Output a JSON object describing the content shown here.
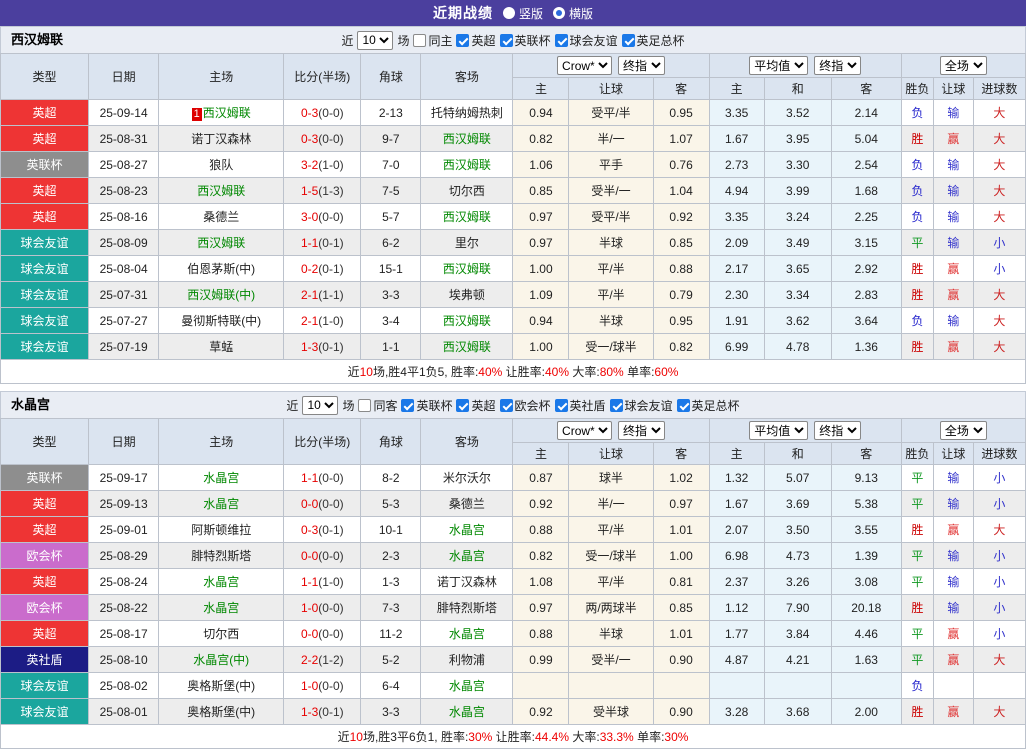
{
  "titlebar": {
    "title": "近期战绩",
    "vertical_label": "竖版",
    "horizontal_label": "横版",
    "vertical_checked": false,
    "horizontal_checked": true
  },
  "filter_labels": {
    "near": "近",
    "count": "10",
    "games": "场"
  },
  "header": {
    "cols": {
      "type": "类型",
      "date": "日期",
      "home": "主场",
      "score": "比分(半场)",
      "corner": "角球",
      "away": "客场"
    },
    "dropdowns": {
      "odds_source": "Crow*",
      "odds_stage": "终指",
      "avg": "平均值",
      "avg_stage": "终指",
      "scope": "全场"
    },
    "sub_cols": [
      "主",
      "让球",
      "客",
      "主",
      "和",
      "客",
      "胜负",
      "让球",
      "进球数"
    ]
  },
  "league_colors": {
    "英超": "#ee3434",
    "英联杯": "#8e8e8e",
    "球会友谊": "#1ba69e",
    "欧会杯": "#ca6ccc",
    "英社盾": "#1c1c85"
  },
  "result_colors": {
    "胜": "#cc0000",
    "赢": "#e03333",
    "平": "#119922",
    "负": "#2222cc",
    "输": "#3333cc",
    "大": "#cc2222",
    "小": "#3333cc"
  },
  "sections": [
    {
      "team": "西汉姆联",
      "same_label": "同主",
      "leagues": [
        "英超",
        "英联杯",
        "球会友谊",
        "英足总杯"
      ],
      "rows": [
        {
          "league": "英超",
          "date": "25-09-14",
          "badge": "1",
          "home": "西汉姆联",
          "homeGreen": true,
          "score": "0-3",
          "half": "(0-0)",
          "corner": "2-13",
          "away": "托特纳姆热刺",
          "awayGreen": false,
          "o1": "0.94",
          "hc": "受平/半",
          "o2": "0.95",
          "a1": "3.35",
          "a2": "3.52",
          "a3": "2.14",
          "r1": "负",
          "r2": "输",
          "r3": "大"
        },
        {
          "league": "英超",
          "date": "25-08-31",
          "home": "诺丁汉森林",
          "homeGreen": false,
          "score": "0-3",
          "half": "(0-0)",
          "corner": "9-7",
          "away": "西汉姆联",
          "awayGreen": true,
          "o1": "0.82",
          "hc": "半/一",
          "o2": "1.07",
          "a1": "1.67",
          "a2": "3.95",
          "a3": "5.04",
          "r1": "胜",
          "r2": "赢",
          "r3": "大"
        },
        {
          "league": "英联杯",
          "date": "25-08-27",
          "home": "狼队",
          "homeGreen": false,
          "score": "3-2",
          "half": "(1-0)",
          "corner": "7-0",
          "away": "西汉姆联",
          "awayGreen": true,
          "o1": "1.06",
          "hc": "平手",
          "o2": "0.76",
          "a1": "2.73",
          "a2": "3.30",
          "a3": "2.54",
          "r1": "负",
          "r2": "输",
          "r3": "大"
        },
        {
          "league": "英超",
          "date": "25-08-23",
          "home": "西汉姆联",
          "homeGreen": true,
          "score": "1-5",
          "half": "(1-3)",
          "corner": "7-5",
          "away": "切尔西",
          "awayGreen": false,
          "o1": "0.85",
          "hc": "受半/一",
          "o2": "1.04",
          "a1": "4.94",
          "a2": "3.99",
          "a3": "1.68",
          "r1": "负",
          "r2": "输",
          "r3": "大"
        },
        {
          "league": "英超",
          "date": "25-08-16",
          "home": "桑德兰",
          "homeGreen": false,
          "score": "3-0",
          "half": "(0-0)",
          "corner": "5-7",
          "away": "西汉姆联",
          "awayGreen": true,
          "o1": "0.97",
          "hc": "受平/半",
          "o2": "0.92",
          "a1": "3.35",
          "a2": "3.24",
          "a3": "2.25",
          "r1": "负",
          "r2": "输",
          "r3": "大"
        },
        {
          "league": "球会友谊",
          "date": "25-08-09",
          "home": "西汉姆联",
          "homeGreen": true,
          "score": "1-1",
          "half": "(0-1)",
          "corner": "6-2",
          "away": "里尔",
          "awayGreen": false,
          "o1": "0.97",
          "hc": "半球",
          "o2": "0.85",
          "a1": "2.09",
          "a2": "3.49",
          "a3": "3.15",
          "r1": "平",
          "r2": "输",
          "r3": "小"
        },
        {
          "league": "球会友谊",
          "date": "25-08-04",
          "home": "伯恩茅斯(中)",
          "homeGreen": false,
          "score": "0-2",
          "half": "(0-1)",
          "corner": "15-1",
          "away": "西汉姆联",
          "awayGreen": true,
          "o1": "1.00",
          "hc": "平/半",
          "o2": "0.88",
          "a1": "2.17",
          "a2": "3.65",
          "a3": "2.92",
          "r1": "胜",
          "r2": "赢",
          "r3": "小"
        },
        {
          "league": "球会友谊",
          "date": "25-07-31",
          "home": "西汉姆联(中)",
          "homeGreen": true,
          "score": "2-1",
          "half": "(1-1)",
          "corner": "3-3",
          "away": "埃弗顿",
          "awayGreen": false,
          "o1": "1.09",
          "hc": "平/半",
          "o2": "0.79",
          "a1": "2.30",
          "a2": "3.34",
          "a3": "2.83",
          "r1": "胜",
          "r2": "赢",
          "r3": "大"
        },
        {
          "league": "球会友谊",
          "date": "25-07-27",
          "home": "曼彻斯特联(中)",
          "homeGreen": false,
          "score": "2-1",
          "half": "(1-0)",
          "corner": "3-4",
          "away": "西汉姆联",
          "awayGreen": true,
          "o1": "0.94",
          "hc": "半球",
          "o2": "0.95",
          "a1": "1.91",
          "a2": "3.62",
          "a3": "3.64",
          "r1": "负",
          "r2": "输",
          "r3": "大"
        },
        {
          "league": "球会友谊",
          "date": "25-07-19",
          "home": "草蜢",
          "homeGreen": false,
          "score": "1-3",
          "half": "(0-1)",
          "corner": "1-1",
          "away": "西汉姆联",
          "awayGreen": true,
          "o1": "1.00",
          "hc": "受一/球半",
          "o2": "0.82",
          "a1": "6.99",
          "a2": "4.78",
          "a3": "1.36",
          "r1": "胜",
          "r2": "赢",
          "r3": "大"
        }
      ],
      "summary": [
        [
          "近",
          0
        ],
        [
          "10",
          1
        ],
        [
          "场,胜4平1负5, 胜率:",
          0
        ],
        [
          "40%",
          1
        ],
        [
          " 让胜率:",
          0
        ],
        [
          "40%",
          1
        ],
        [
          " 大率:",
          0
        ],
        [
          "80%",
          1
        ],
        [
          " 单率:",
          0
        ],
        [
          "60%",
          1
        ]
      ]
    },
    {
      "team": "水晶宫",
      "same_label": "同客",
      "leagues": [
        "英联杯",
        "英超",
        "欧会杯",
        "英社盾",
        "球会友谊",
        "英足总杯"
      ],
      "rows": [
        {
          "league": "英联杯",
          "date": "25-09-17",
          "home": "水晶宫",
          "homeGreen": true,
          "score": "1-1",
          "half": "(0-0)",
          "corner": "8-2",
          "away": "米尔沃尔",
          "awayGreen": false,
          "o1": "0.87",
          "hc": "球半",
          "o2": "1.02",
          "a1": "1.32",
          "a2": "5.07",
          "a3": "9.13",
          "r1": "平",
          "r2": "输",
          "r3": "小"
        },
        {
          "league": "英超",
          "date": "25-09-13",
          "home": "水晶宫",
          "homeGreen": true,
          "score": "0-0",
          "half": "(0-0)",
          "corner": "5-3",
          "away": "桑德兰",
          "awayGreen": false,
          "o1": "0.92",
          "hc": "半/一",
          "o2": "0.97",
          "a1": "1.67",
          "a2": "3.69",
          "a3": "5.38",
          "r1": "平",
          "r2": "输",
          "r3": "小"
        },
        {
          "league": "英超",
          "date": "25-09-01",
          "home": "阿斯顿维拉",
          "homeGreen": false,
          "score": "0-3",
          "half": "(0-1)",
          "corner": "10-1",
          "away": "水晶宫",
          "awayGreen": true,
          "o1": "0.88",
          "hc": "平/半",
          "o2": "1.01",
          "a1": "2.07",
          "a2": "3.50",
          "a3": "3.55",
          "r1": "胜",
          "r2": "赢",
          "r3": "大"
        },
        {
          "league": "欧会杯",
          "date": "25-08-29",
          "home": "腓特烈斯塔",
          "homeGreen": false,
          "score": "0-0",
          "half": "(0-0)",
          "corner": "2-3",
          "away": "水晶宫",
          "awayGreen": true,
          "o1": "0.82",
          "hc": "受一/球半",
          "o2": "1.00",
          "a1": "6.98",
          "a2": "4.73",
          "a3": "1.39",
          "r1": "平",
          "r2": "输",
          "r3": "小"
        },
        {
          "league": "英超",
          "date": "25-08-24",
          "home": "水晶宫",
          "homeGreen": true,
          "score": "1-1",
          "half": "(1-0)",
          "corner": "1-3",
          "away": "诺丁汉森林",
          "awayGreen": false,
          "o1": "1.08",
          "hc": "平/半",
          "o2": "0.81",
          "a1": "2.37",
          "a2": "3.26",
          "a3": "3.08",
          "r1": "平",
          "r2": "输",
          "r3": "小"
        },
        {
          "league": "欧会杯",
          "date": "25-08-22",
          "home": "水晶宫",
          "homeGreen": true,
          "score": "1-0",
          "half": "(0-0)",
          "corner": "7-3",
          "away": "腓特烈斯塔",
          "awayGreen": false,
          "o1": "0.97",
          "hc": "两/两球半",
          "o2": "0.85",
          "a1": "1.12",
          "a2": "7.90",
          "a3": "20.18",
          "r1": "胜",
          "r2": "输",
          "r3": "小"
        },
        {
          "league": "英超",
          "date": "25-08-17",
          "home": "切尔西",
          "homeGreen": false,
          "score": "0-0",
          "half": "(0-0)",
          "corner": "11-2",
          "away": "水晶宫",
          "awayGreen": true,
          "o1": "0.88",
          "hc": "半球",
          "o2": "1.01",
          "a1": "1.77",
          "a2": "3.84",
          "a3": "4.46",
          "r1": "平",
          "r2": "赢",
          "r3": "小"
        },
        {
          "league": "英社盾",
          "date": "25-08-10",
          "home": "水晶宫(中)",
          "homeGreen": true,
          "score": "2-2",
          "half": "(1-2)",
          "corner": "5-2",
          "away": "利物浦",
          "awayGreen": false,
          "o1": "0.99",
          "hc": "受半/一",
          "o2": "0.90",
          "a1": "4.87",
          "a2": "4.21",
          "a3": "1.63",
          "r1": "平",
          "r2": "赢",
          "r3": "大"
        },
        {
          "league": "球会友谊",
          "date": "25-08-02",
          "home": "奥格斯堡(中)",
          "homeGreen": false,
          "score": "1-0",
          "half": "(0-0)",
          "corner": "6-4",
          "away": "水晶宫",
          "awayGreen": true,
          "o1": "",
          "hc": "",
          "o2": "",
          "a1": "",
          "a2": "",
          "a3": "",
          "r1": "负",
          "r2": "",
          "r3": ""
        },
        {
          "league": "球会友谊",
          "date": "25-08-01",
          "home": "奥格斯堡(中)",
          "homeGreen": false,
          "score": "1-3",
          "half": "(0-1)",
          "corner": "3-3",
          "away": "水晶宫",
          "awayGreen": true,
          "o1": "0.92",
          "hc": "受半球",
          "o2": "0.90",
          "a1": "3.28",
          "a2": "3.68",
          "a3": "2.00",
          "r1": "胜",
          "r2": "赢",
          "r3": "大"
        }
      ],
      "summary": [
        [
          "近",
          0
        ],
        [
          "10",
          1
        ],
        [
          "场,胜3平6负1, 胜率:",
          0
        ],
        [
          "30%",
          1
        ],
        [
          " 让胜率:",
          0
        ],
        [
          "44.4%",
          1
        ],
        [
          " 大率:",
          0
        ],
        [
          "33.3%",
          1
        ],
        [
          " 单率:",
          0
        ],
        [
          "30%",
          1
        ]
      ]
    }
  ]
}
